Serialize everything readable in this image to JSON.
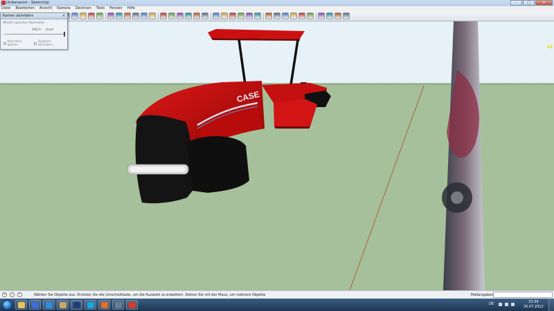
{
  "window": {
    "title": "Unbenannt - SketchUp",
    "buttons": {
      "minimize": "–",
      "maximize": "□",
      "close": "✕"
    }
  },
  "menubar": {
    "items": [
      "Datei",
      "Bearbeiten",
      "Ansicht",
      "Kamera",
      "Zeichnen",
      "Tools",
      "Fenster",
      "Hilfe"
    ]
  },
  "toolbar": {
    "tools": [
      "select-tool",
      "make-component-tool",
      "paint-bucket-tool",
      "eraser-tool",
      "rectangle-tool",
      "line-tool",
      "circle-tool",
      "arc-tool",
      "polygon-tool",
      "freehand-tool",
      "move-tool",
      "push-pull-tool",
      "rotate-tool",
      "follow-me-tool",
      "scale-tool",
      "offset-tool",
      "orbit-tool",
      "pan-tool",
      "zoom-tool",
      "zoom-window-tool",
      "zoom-extents-tool",
      "previous-view-tool",
      "tape-measure-tool",
      "dimension-tool",
      "protractor-tool",
      "text-tool",
      "axes-tool",
      "3d-text-tool",
      "position-camera-tool",
      "walk-tool",
      "look-around-tool",
      "section-plane-tool",
      "get-models-tool",
      "share-model-tool",
      "share-component-tool",
      "preview-google-earth-tool",
      "add-location-tool",
      "toggle-terrain-tool",
      "photo-textures-tool",
      "extension-warehouse-tool"
    ]
  },
  "soften_edges_panel": {
    "title": "Kanten abmildern",
    "close_label": "✕",
    "angle_label": "Winkel zwischen Normalen",
    "angle_value": "180,0",
    "angle_unit": "Grad",
    "angle_fraction": 1.0,
    "check_normals": "Normalen glätten",
    "check_coplanar": "Koplanar abmildern"
  },
  "viewport": {
    "fps": "44",
    "sky_color": "#e6f1f8",
    "ground_color": "#a5c09a",
    "model_red": "#c40d0d",
    "model_dark": "#151515"
  },
  "statusbar": {
    "hint": "Wählen Sie Objekte aus. Drücken Sie die Umschalttaste, um die Auswahl zu erweitern. Ziehen Sie mit der Maus, um mehrere Objekte",
    "measurement_label": "Maßangaben",
    "measurement_value": "",
    "icons": [
      "geo-location-icon",
      "credits-icon",
      "help-icon"
    ]
  },
  "taskbar": {
    "pinned": [
      "explorer-icon",
      "media-player-icon",
      "internet-explorer-icon",
      "paint-icon",
      "photoshop-icon",
      "skype-icon",
      "firefox-icon",
      "misc-app-icon",
      "sketchup-icon"
    ],
    "language": "DE",
    "time": "15:39",
    "date": "26.07.2012"
  }
}
